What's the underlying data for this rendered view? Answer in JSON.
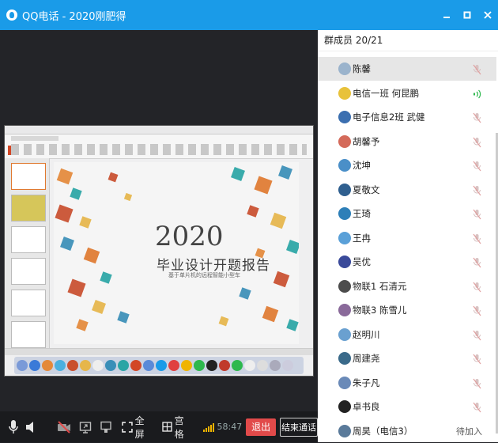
{
  "window": {
    "title": "QQ电话 - 2020刚肥得"
  },
  "members_header": "群成员 20/21",
  "members": [
    {
      "name": "陈馨",
      "status": "muted",
      "avatar_color": "#9ab3cc"
    },
    {
      "name": "电信一班  何昆鹏",
      "status": "speaking",
      "avatar_color": "#e8c23a"
    },
    {
      "name": "电子信息2班  武健",
      "status": "muted",
      "avatar_color": "#3b6fb0"
    },
    {
      "name": "胡馨予",
      "status": "muted",
      "avatar_color": "#d46a5a"
    },
    {
      "name": "沈坤",
      "status": "muted",
      "avatar_color": "#4a8fc8"
    },
    {
      "name": "夏敬文",
      "status": "muted",
      "avatar_color": "#2f5f8f"
    },
    {
      "name": "王琦",
      "status": "muted",
      "avatar_color": "#2d7fb8"
    },
    {
      "name": "王冉",
      "status": "muted",
      "avatar_color": "#5aa0d8"
    },
    {
      "name": "吴优",
      "status": "muted",
      "avatar_color": "#3a4a9a"
    },
    {
      "name": "物联1  石清元",
      "status": "muted",
      "avatar_color": "#4c4c4c"
    },
    {
      "name": "物联3  陈雪儿",
      "status": "muted",
      "avatar_color": "#8a6a9a"
    },
    {
      "name": "赵明川",
      "status": "muted",
      "avatar_color": "#6aa0d0"
    },
    {
      "name": "周建尧",
      "status": "muted",
      "avatar_color": "#3a6a8a"
    },
    {
      "name": "朱子凡",
      "status": "muted",
      "avatar_color": "#6a8ab8"
    },
    {
      "name": "卓书良",
      "status": "muted",
      "avatar_color": "#222222"
    },
    {
      "name": "周昊（电信3）",
      "status": "pending",
      "status_text": "待加入",
      "avatar_color": "#5a7a9a"
    }
  ],
  "controls": {
    "fullscreen": "全屏",
    "grid": "宫格",
    "timer": "58:47",
    "exit": "退出",
    "end_call": "结束通话"
  },
  "shared_screen": {
    "slide_year": "2020",
    "slide_title": "毕业设计开题报告",
    "slide_subtitle": "基于单片机的远程智能小型车"
  },
  "colors": {
    "titlebar": "#1a9be8",
    "exit_button": "#e14a4a",
    "speaking": "#2db84d",
    "signal": "#f0b400"
  }
}
